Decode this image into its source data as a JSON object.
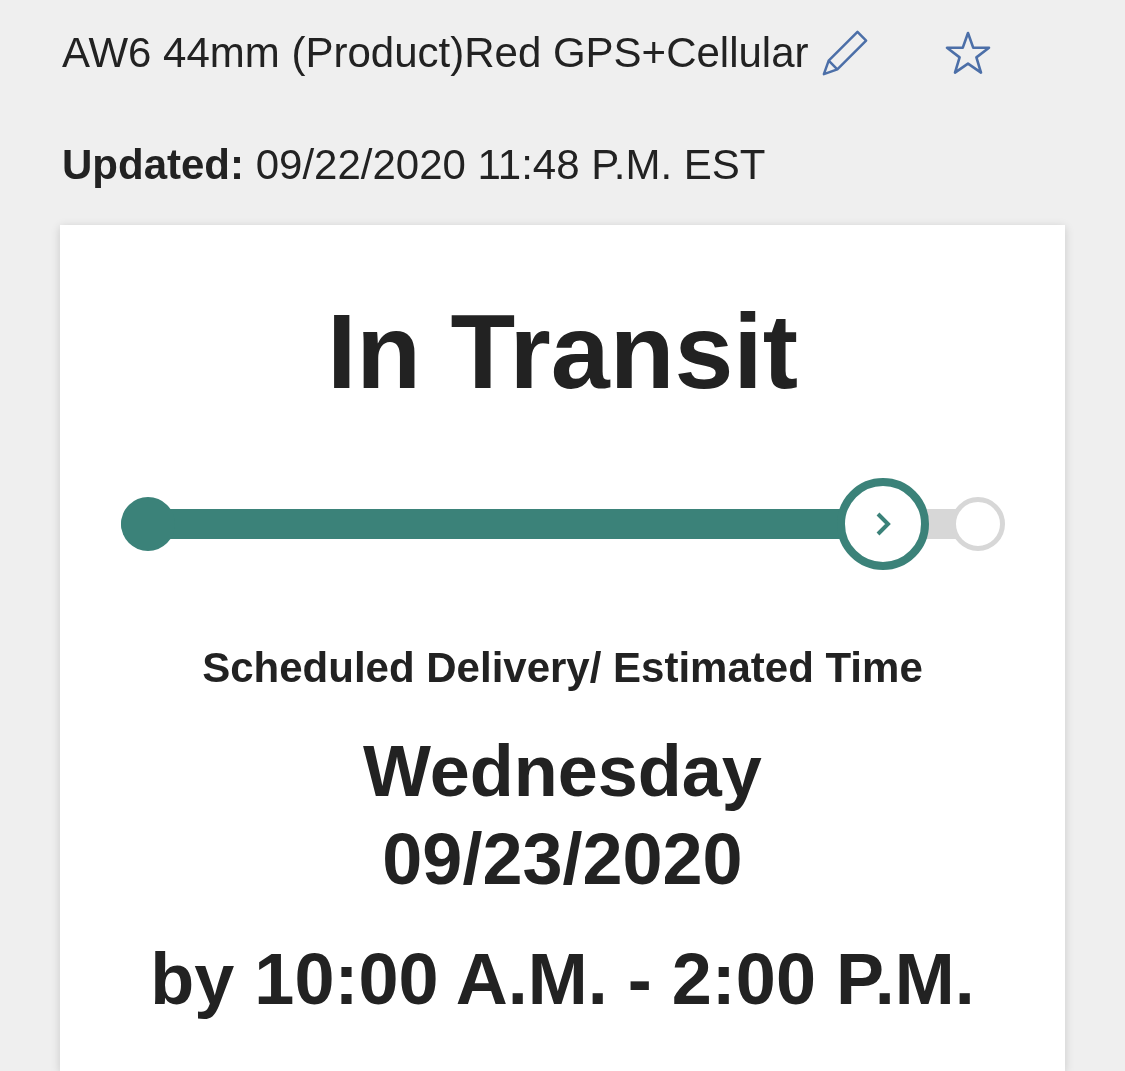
{
  "product": {
    "title": "AW6 44mm (Product)Red GPS+Cellular",
    "favorite": false
  },
  "updated": "**Updated:** 09/22/2020 11:48 P.M. EST",
  "status": {
    "title": "In Transit",
    "progress": {
      "level": 0.862
    }
  },
  "delivery": {
    "label": "Scheduled Delivery/ Estimated Time",
    "day": "Wednesday",
    "date": "09/23/2020",
    "window": "by 10:00 A.M. - 2:00 P.M."
  }
}
